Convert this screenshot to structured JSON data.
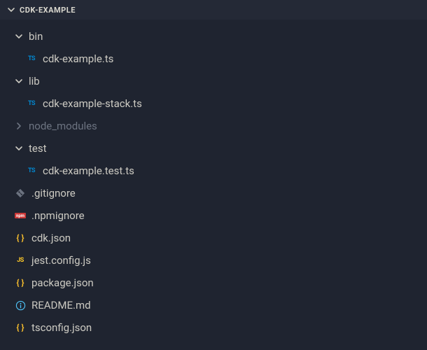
{
  "header": {
    "title": "CDK-EXAMPLE"
  },
  "tree": {
    "items": [
      {
        "kind": "folder",
        "name": "bin",
        "state": "open",
        "indent": 0
      },
      {
        "kind": "file",
        "name": "cdk-example.ts",
        "icon": "ts",
        "indent": 1
      },
      {
        "kind": "folder",
        "name": "lib",
        "state": "open",
        "indent": 0
      },
      {
        "kind": "file",
        "name": "cdk-example-stack.ts",
        "icon": "ts",
        "indent": 1
      },
      {
        "kind": "folder",
        "name": "node_modules",
        "state": "closed",
        "indent": 0,
        "dim": true
      },
      {
        "kind": "folder",
        "name": "test",
        "state": "open",
        "indent": 0
      },
      {
        "kind": "file",
        "name": "cdk-example.test.ts",
        "icon": "ts",
        "indent": 1
      },
      {
        "kind": "file",
        "name": ".gitignore",
        "icon": "git",
        "indent": 0
      },
      {
        "kind": "file",
        "name": ".npmignore",
        "icon": "npm",
        "indent": 0
      },
      {
        "kind": "file",
        "name": "cdk.json",
        "icon": "json",
        "indent": 0
      },
      {
        "kind": "file",
        "name": "jest.config.js",
        "icon": "js",
        "indent": 0
      },
      {
        "kind": "file",
        "name": "package.json",
        "icon": "json",
        "indent": 0
      },
      {
        "kind": "file",
        "name": "README.md",
        "icon": "info",
        "indent": 0
      },
      {
        "kind": "file",
        "name": "tsconfig.json",
        "icon": "json",
        "indent": 0
      }
    ]
  },
  "icons": {
    "ts_label": "TS",
    "js_label": "JS",
    "json_label": "{ }",
    "npm_label": "npm"
  }
}
